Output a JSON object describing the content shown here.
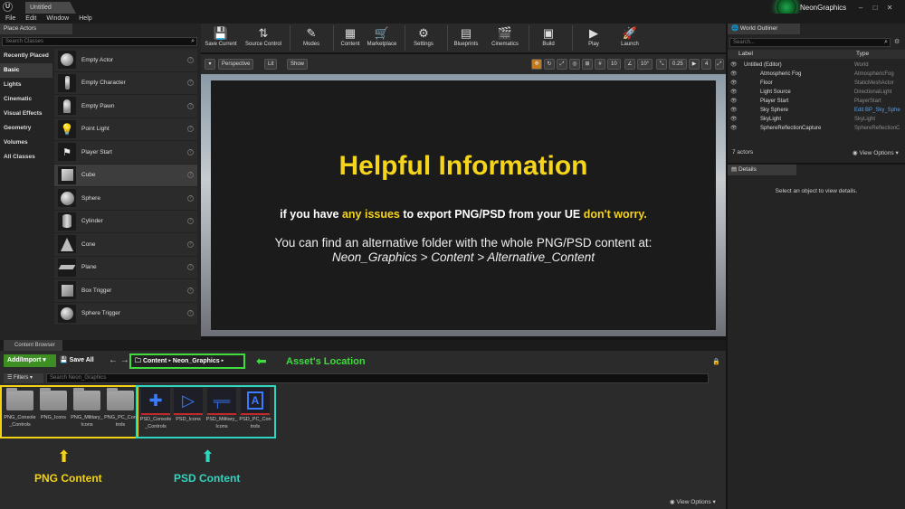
{
  "window": {
    "tab_title": "Untitled",
    "brand_name": "NeonGraphics",
    "menu": [
      "File",
      "Edit",
      "Window",
      "Help"
    ]
  },
  "place_actors": {
    "tab_label": "Place Actors",
    "search_placeholder": "Search Classes",
    "categories": [
      "Recently Placed",
      "Basic",
      "Lights",
      "Cinematic",
      "Visual Effects",
      "Geometry",
      "Volumes",
      "All Classes"
    ],
    "active_category": "Basic",
    "actors": [
      "Empty Actor",
      "Empty Character",
      "Empty Pawn",
      "Point Light",
      "Player Start",
      "Cube",
      "Sphere",
      "Cylinder",
      "Cone",
      "Plane",
      "Box Trigger",
      "Sphere Trigger"
    ],
    "selected_actor": "Cube"
  },
  "toolbar": {
    "buttons": [
      "Save Current",
      "Source Control",
      "Modes",
      "Content",
      "Marketplace",
      "Settings",
      "Blueprints",
      "Cinematics",
      "Build",
      "Play",
      "Launch"
    ]
  },
  "viewport": {
    "perspective": "Perspective",
    "lit": "Lit",
    "show": "Show",
    "grid_snap": "10",
    "rotation_snap": "10°",
    "scale_snap": "0.25",
    "camera_speed": "4"
  },
  "info_card": {
    "title": "Helpful Information",
    "line1_a": "if you have ",
    "line1_b": "any issues",
    "line1_c": " to export PNG/PSD from your UE ",
    "line1_d": "don't worry.",
    "line2": "You can find an alternative folder with the whole PNG/PSD content at:",
    "line3": "Neon_Graphics > Content > Alternative_Content"
  },
  "content_browser": {
    "tab_label": "Content Browser",
    "add_import": "Add/Import",
    "save_all": "Save All",
    "path": [
      "Content",
      "Neon_Graphics"
    ],
    "asset_location_label": "Asset's Location",
    "filters": "Filters",
    "search_placeholder": "Search Neon_Graphics",
    "png_folders": [
      "PNG_Console_Controls",
      "PNG_Icons",
      "PNG_Military_Icons",
      "PNG_PC_Controls"
    ],
    "psd_assets": [
      "PSD_Console_Controls",
      "PSD_Icons",
      "PSD_Military_Icons",
      "PSD_PC_Controls"
    ],
    "png_label": "PNG Content",
    "psd_label": "PSD Content",
    "view_options": "View Options"
  },
  "world_outliner": {
    "tab_label": "World Outliner",
    "search_placeholder": "Search...",
    "col_label": "Label",
    "col_type": "Type",
    "rows": [
      {
        "label": "Untitled (Editor)",
        "type": "World"
      },
      {
        "label": "Atmospheric Fog",
        "type": "AtmosphericFog"
      },
      {
        "label": "Floor",
        "type": "StaticMeshActor"
      },
      {
        "label": "Light Source",
        "type": "DirectionalLight"
      },
      {
        "label": "Player Start",
        "type": "PlayerStart"
      },
      {
        "label": "Sky Sphere",
        "type": "Edit BP_Sky_Sphe"
      },
      {
        "label": "SkyLight",
        "type": "SkyLight"
      },
      {
        "label": "SphereReflectionCapture",
        "type": "SphereReflectionC"
      }
    ],
    "actor_count": "7 actors",
    "view_options": "View Options"
  },
  "details": {
    "tab_label": "Details",
    "empty_message": "Select an object to view details."
  }
}
